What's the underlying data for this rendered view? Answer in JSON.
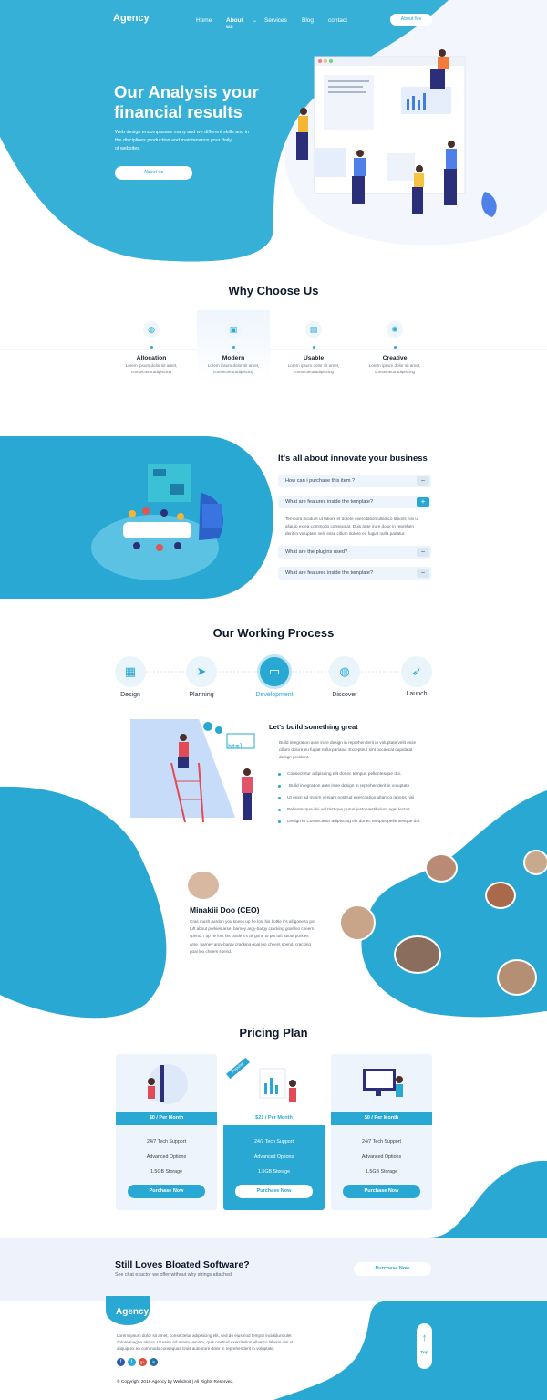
{
  "brand": "Agency",
  "nav": {
    "items": [
      "Home",
      "About us",
      "Services",
      "Blog",
      "contact"
    ],
    "about_button": "About Me"
  },
  "hero": {
    "title_line1": "Our Analysis your",
    "title_line2": "financial results",
    "desc_line1": "Web design encompasses many  and we different skills and  in",
    "desc_line2": "the  disciplines  production and maintenance your daily",
    "desc_line3": "of websites.",
    "button": "About us"
  },
  "why": {
    "title": "Why Choose Us",
    "items": [
      {
        "title": "Allocation",
        "l1": "Lorem ipsum dolor sit amet,",
        "l2": "consecteturadipiscing",
        "icon": "globe-icon"
      },
      {
        "title": "Modern",
        "l1": "Lorem ipsum dolor sit amet,",
        "l2": "consecteturadipiscing",
        "icon": "image-icon"
      },
      {
        "title": "Usable",
        "l1": "Lorem ipsum dolor sit amet,",
        "l2": "consecteturadipiscing",
        "icon": "document-icon"
      },
      {
        "title": "Creative",
        "l1": "Lorem ipsum dolor sit amet,",
        "l2": "consecteturadipiscing",
        "icon": "palette-icon"
      }
    ]
  },
  "innovate": {
    "title": "It's all about innovate your business",
    "faqs": [
      {
        "q": "How can i purchase this item ?",
        "toggle": "−"
      },
      {
        "q": "What are features inside the template?",
        "toggle": "+"
      },
      {
        "q": "What are the plugins used?",
        "toggle": "−"
      },
      {
        "q": "What are features inside the template?",
        "toggle": "−"
      }
    ],
    "answer_l1": "Tempora incidunt ut labore et dolore exercitation ullamco laboris nisi ut",
    "answer_l2": "aliquip ex ea commodo consequat. Duis aute irure dolor in reprehen",
    "answer_l3": "derit in voluptate velit esse cillum dolore eu fugiat nulla pariatur."
  },
  "process": {
    "title": "Our Working Process",
    "steps": [
      "Design",
      "Planning",
      "Development",
      "Discover",
      "Launch"
    ],
    "build_title": "Let's build something great",
    "p_l1": "Build integration aute irure design in reprehenderit in voluptate velit esse",
    "p_l2": "cillum dolore eu fugiat nulla pariatur. Excepteur sint occaecat cupidatat",
    "p_l3": "design proident.",
    "bullets": [
      "Consectetur adipiscing elit donec tempus pellentesque dui.",
      "Build integration aute irure design in reprehenderit in voluptate",
      "Ut enim ad minim veniam nostrud exercitation ullamco laboris nisi",
      "Pellentesque dui vel tristique purus justo vestibulum eget lectus.",
      "Design in Consectetur adipiscing elit donec tempus pellentesque dui."
    ],
    "html_tag": "html"
  },
  "testimonial": {
    "name": "Minakiii Doo (CEO)",
    "t1": "Cras mush pardon you knees up he lost his bottle it's all gone to pot",
    "t2": "tuft about porkies arse, barney argy-bargy cracking goal loo cheers",
    "t3": "spend. I up he lost his bottle it's all gone to pot tuft about porkies",
    "t4": "arse, barney argy-bargy cracking goal loo cheers spend. cracking",
    "t5": "goal loo cheers spend."
  },
  "pricing": {
    "title": "Pricing Plan",
    "ribbon": "Popular",
    "plans": [
      {
        "price": "$0 / Per Month",
        "f1": "24/7 Tech Support",
        "f2": "Advanced Options",
        "f3": "1.5GB Storage",
        "button": "Purchase Now"
      },
      {
        "price": "$21 / Per Month",
        "f1": "24/7 Tech Support",
        "f2": "Advanced Options",
        "f3": "1.5GB Storage",
        "button": "Purchase Now"
      },
      {
        "price": "$0 / Per Month",
        "f1": "24/7 Tech Support",
        "f2": "Advanced Options",
        "f3": "1.5GB Storage",
        "button": "Purchase Now"
      }
    ]
  },
  "cta": {
    "title": "Still Loves Bloated Software?",
    "subtitle": "See chat exactor we offer without why strings attached",
    "button": "Purchase Now"
  },
  "footer": {
    "brand": "Agency",
    "l1": "Lorem ipsum dolor sit amet, consectetur adipisicing elit, sed do eiusmod tempor incididunt ulet",
    "l2": "dolore magna aliqua. Ut enim ad minim veniam, quis nostrud exercitation ullamco laboris nisi ut",
    "l3": "aliquip ex ea commodo consequat. Duis aute irure dolor in reprehenderit in voluptate.",
    "social": [
      "f",
      "t",
      "g+",
      "in"
    ],
    "copyright": "© Copyright 2019 Agency by Webdroit  |  All Rights Reserved.",
    "top": "Top"
  },
  "colors": {
    "accent": "#29a8d3",
    "dark": "#0e1a2b",
    "light": "#eef4fb"
  }
}
